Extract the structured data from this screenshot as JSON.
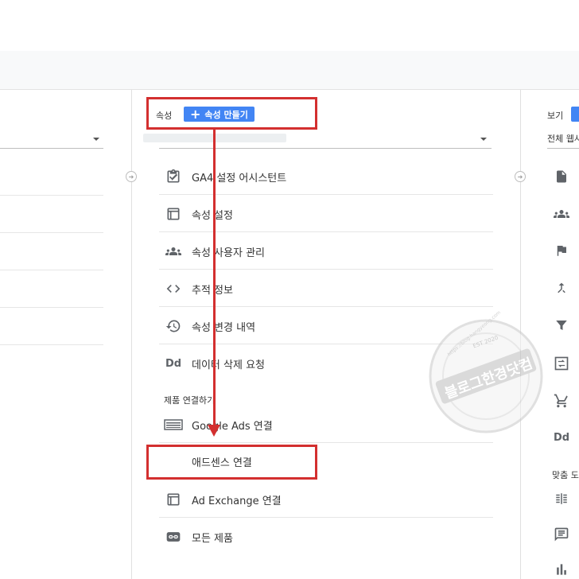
{
  "middle_column": {
    "header_label": "속성",
    "create_button_label": "속성 만들기",
    "items": [
      {
        "icon": "clipboard-check-icon",
        "label": "GA4 설정 어시스턴트"
      },
      {
        "icon": "window-layout-icon",
        "label": "속성 설정"
      },
      {
        "icon": "people-icon",
        "label": "속성 사용자 관리"
      },
      {
        "icon": "code-brackets-icon",
        "label": "추적 정보"
      },
      {
        "icon": "history-icon",
        "label": "속성 변경 내역"
      },
      {
        "icon": "data-deletion-icon",
        "label": "데이터 삭제 요청"
      }
    ],
    "section_label": "제품 연결하기",
    "product_items": [
      {
        "icon": "google-ads-icon",
        "label": "Google Ads 연결"
      },
      {
        "icon": "",
        "label": "애드센스 연결"
      },
      {
        "icon": "window-layout-icon",
        "label": "Ad Exchange 연결"
      },
      {
        "icon": "link-icon",
        "label": "모든 제품"
      }
    ]
  },
  "right_column": {
    "header_label": "보기",
    "dropdown_value": "전체 웹사",
    "icons": [
      "document-icon",
      "people-icon",
      "flag-icon",
      "merge-icon",
      "filter-icon",
      "data-import-icon",
      "cart-icon",
      "data-deletion-icon"
    ],
    "section_label": "맞춤 도",
    "extra_icons": [
      "columns-icon",
      "comment-icon",
      "bar-chart-icon"
    ]
  },
  "annotations": {
    "arrow_color": "#d32f2f",
    "highlight_color": "#d32f2f"
  },
  "watermark": {
    "text": "블로그한경닷컴",
    "url": "https://blog.hangyeong.com",
    "est": "EST 2020"
  },
  "colors": {
    "accent": "#4285f4",
    "icon": "#5f6368"
  }
}
